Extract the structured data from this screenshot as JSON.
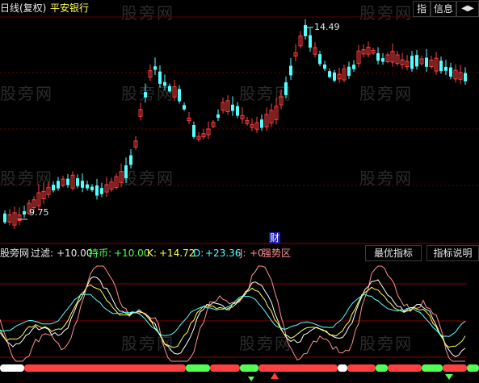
{
  "header": {
    "title": "日线(复权)",
    "stock": "平安银行",
    "btn_index": "指",
    "btn_info": "信息",
    "btn_nav": "◀▶"
  },
  "price_panel": {
    "high_label": "14.49",
    "low_label": "9.75",
    "marker": "财"
  },
  "indicator_panel": {
    "name": "股旁网",
    "guolv_label": "过滤:",
    "guolv_value": "+10.00",
    "chibi_label": "持币:",
    "chibi_value": "+10.00",
    "k_label": "K:",
    "k_value": "+14.72",
    "d_label": "D:",
    "d_value": "+23.36",
    "j_label": "J:",
    "j_value": "+0",
    "status": "强势区",
    "btn_best": "最优指标",
    "btn_explain": "指标说明"
  },
  "watermark": "股旁网",
  "colors": {
    "up": "#ff4040",
    "down": "#54ffff",
    "grid": "#6b0000",
    "white": "#ffffff",
    "yellow": "#ffff54",
    "green": "#54ff54",
    "pink": "#ff9090"
  }
}
